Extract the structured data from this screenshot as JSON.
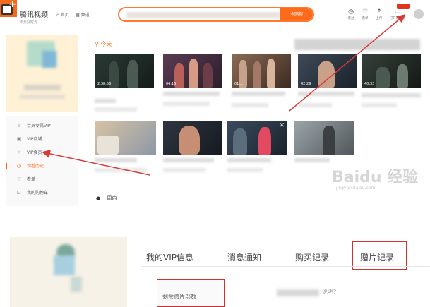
{
  "header": {
    "logo_text": "腾讯视频",
    "logo_slogan": "不负好时光",
    "nav": [
      {
        "label": "首页",
        "icon": "home-icon"
      },
      {
        "label": "频道",
        "icon": "grid-icon"
      }
    ],
    "search_button": "全网搜",
    "tools": [
      {
        "label": "看过",
        "icon": "clock-icon",
        "glyph": "◷"
      },
      {
        "label": "看单",
        "icon": "heart-icon",
        "glyph": "♡"
      },
      {
        "label": "上传",
        "icon": "upload-icon",
        "glyph": "⇡"
      },
      {
        "label": "打开客户端",
        "icon": "client-icon",
        "glyph": "▭"
      }
    ]
  },
  "sidebar": {
    "menu": [
      {
        "label": "会员专属VIP",
        "icon": "crown-icon",
        "glyph": "♕",
        "active": false
      },
      {
        "label": "VIP商城",
        "icon": "shop-icon",
        "glyph": "▣",
        "active": false
      },
      {
        "label": "VIP会员",
        "icon": "star-icon",
        "glyph": "☆",
        "active": false
      },
      {
        "label": "观看历史",
        "icon": "history-icon",
        "glyph": "◷",
        "active": true
      },
      {
        "label": "看单",
        "icon": "heart-icon",
        "glyph": "♡",
        "active": false
      },
      {
        "label": "我的购物车",
        "icon": "cart-icon",
        "glyph": "⊡",
        "active": false
      }
    ]
  },
  "main": {
    "today_label": "今天",
    "week_label": "一周内",
    "row1": [
      {
        "duration": "2:38:56"
      },
      {
        "duration": "04:15"
      },
      {
        "duration": "01:..."
      },
      {
        "duration": "42:29"
      },
      {
        "duration": "40:33"
      }
    ],
    "row2": [
      {
        "duration": ""
      },
      {
        "duration": ""
      },
      {
        "duration": ""
      },
      {
        "duration": ""
      }
    ]
  },
  "watermark": {
    "brand": "Baidu 经验",
    "url": "jingyan.baidu.com"
  },
  "lower": {
    "tabs": [
      {
        "label": "我的VIP信息"
      },
      {
        "label": "消息通知"
      },
      {
        "label": "购买记录"
      },
      {
        "label": "赠片记录"
      }
    ],
    "remain_label": "剩余赠片部数",
    "hint_fragment": "说明？"
  },
  "colors": {
    "accent": "#ff6a1a",
    "highlight_border": "#cc3333",
    "arrow": "#d83a3a"
  }
}
